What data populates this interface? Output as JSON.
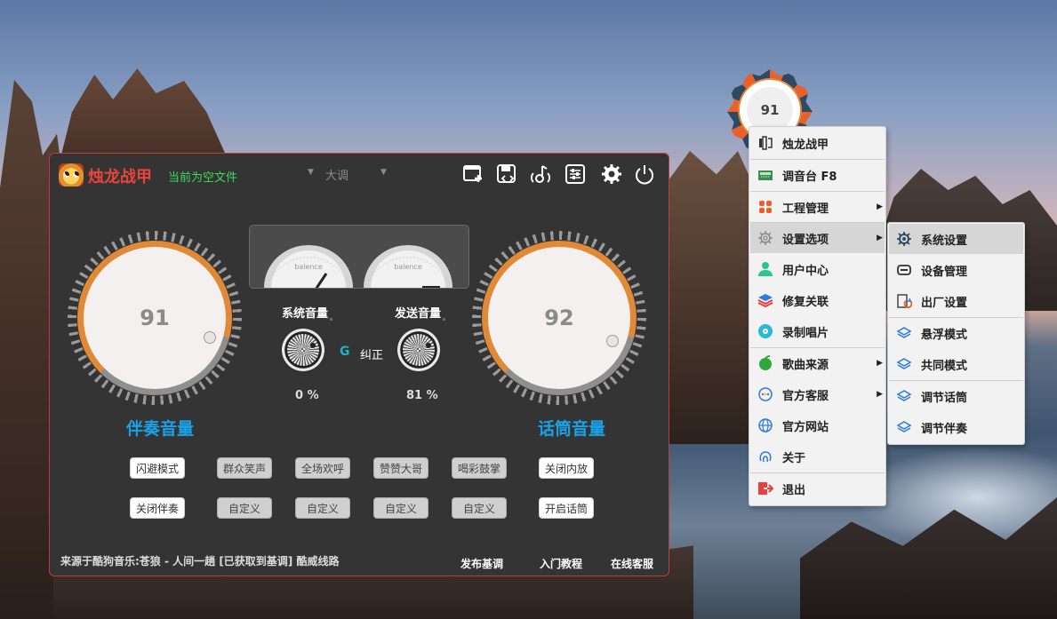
{
  "app": {
    "title": "烛龙战甲",
    "file_status": "当前为空文件",
    "key_value": "大调",
    "toolbar": {
      "new_icon": "new-window-icon",
      "save_icon": "save-icon",
      "music_icon": "music-note-icon",
      "mixer_icon": "equalizer-icon",
      "settings_icon": "gear-icon",
      "power_icon": "power-icon"
    },
    "vu": {
      "left_label": "balence",
      "right_label": "balence"
    },
    "accompaniment": {
      "value": "91",
      "caption": "伴奏音量"
    },
    "mic": {
      "value": "92",
      "caption": "话筒音量"
    },
    "system_volume": {
      "label": "系统音量",
      "percent": "0 %"
    },
    "send_volume": {
      "label": "发送音量",
      "percent": "81 %"
    },
    "calibrate": {
      "icon_text": "G",
      "label": "纠正"
    },
    "effects_row1": [
      "闪避模式",
      "群众笑声",
      "全场欢呼",
      "赞赞大哥",
      "喝彩鼓掌",
      "关闭内放"
    ],
    "effects_row2": [
      "关闭伴奏",
      "自定义",
      "自定义",
      "自定义",
      "自定义",
      "开启话筒"
    ],
    "source_text": "来源于酷狗音乐:苍狼 - 人间一趟 [已获取到基调] 酷威线路",
    "footer_links": [
      "发布基调",
      "入门教程",
      "在线客服"
    ],
    "colors": {
      "accent": "#e08a37",
      "title": "#e8443a",
      "status": "#3fd85a",
      "caption": "#1aa2e8"
    }
  },
  "float_ball": {
    "value": "91"
  },
  "menu": {
    "items": [
      {
        "label": "烛龙战甲",
        "icon": "app-logo-icon",
        "bold": true
      },
      {
        "label": "调音台 F8",
        "icon": "mixer-board-icon"
      },
      {
        "label": "工程管理",
        "icon": "project-grid-icon",
        "submenu": true
      },
      {
        "label": "设置选项",
        "icon": "gear-outline-icon",
        "submenu": true
      },
      {
        "label": "用户中心",
        "icon": "user-icon"
      },
      {
        "label": "修复关联",
        "icon": "layers-icon"
      },
      {
        "label": "录制唱片",
        "icon": "record-disc-icon"
      },
      {
        "label": "歌曲来源",
        "icon": "apple-icon",
        "submenu": true
      },
      {
        "label": "官方客服",
        "icon": "chat-bubble-icon",
        "submenu": true
      },
      {
        "label": "官方网站",
        "icon": "globe-icon"
      },
      {
        "label": "关于",
        "icon": "fingerprint-icon"
      },
      {
        "label": "退出",
        "icon": "exit-icon"
      }
    ],
    "arrow": "▶"
  },
  "submenu": {
    "items": [
      {
        "label": "系统设置",
        "icon": "system-settings-icon"
      },
      {
        "label": "设备管理",
        "icon": "device-icon"
      },
      {
        "label": "出厂设置",
        "icon": "factory-reset-icon"
      },
      {
        "label": "悬浮模式",
        "icon": "float-layers-icon"
      },
      {
        "label": "共同模式",
        "icon": "common-layers-icon"
      },
      {
        "label": "调节话筒",
        "icon": "adjust-mic-icon"
      },
      {
        "label": "调节伴奏",
        "icon": "adjust-accomp-icon"
      }
    ]
  }
}
